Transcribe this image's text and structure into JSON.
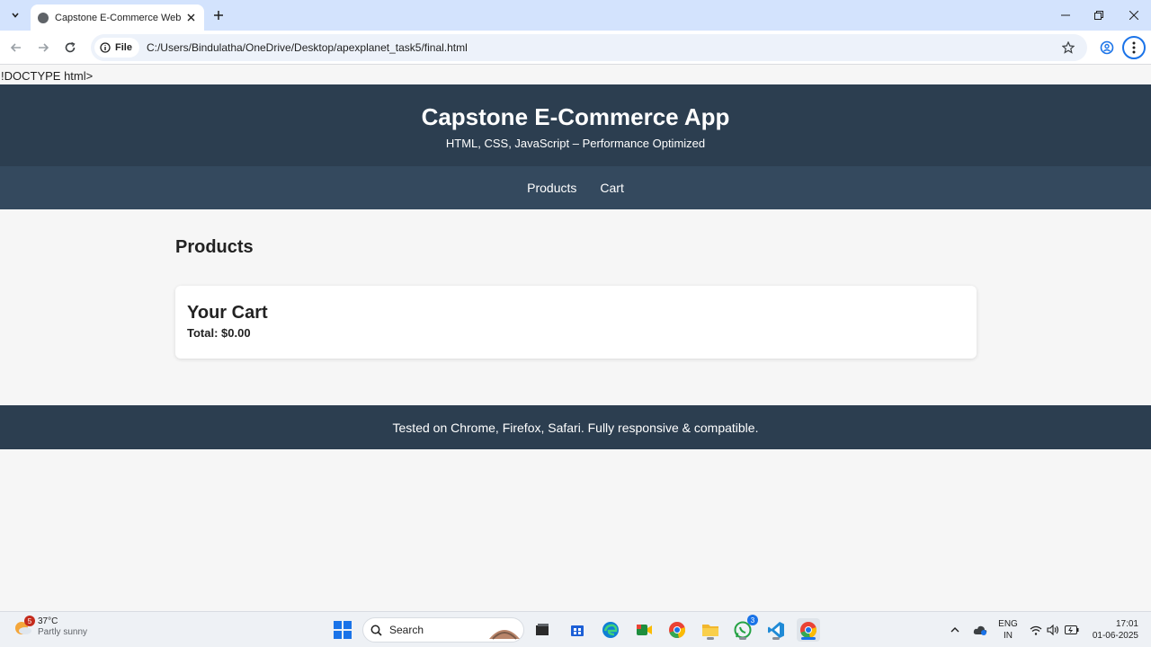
{
  "browser": {
    "tab_title": "Capstone E-Commerce Web App",
    "chip_label": "File",
    "url": "C:/Users/Bindulatha/OneDrive/Desktop/apexplanet_task5/final.html"
  },
  "page": {
    "doctype_text": "!DOCTYPE html>",
    "header": {
      "title": "Capstone E-Commerce App",
      "subtitle": "HTML, CSS, JavaScript – Performance Optimized"
    },
    "nav": {
      "products": "Products",
      "cart": "Cart"
    },
    "products_heading": "Products",
    "cart": {
      "title": "Your Cart",
      "total": "Total: $0.00"
    },
    "footer": "Tested on Chrome, Firefox, Safari. Fully responsive & compatible."
  },
  "taskbar": {
    "weather": {
      "temp": "37°C",
      "desc": "Partly sunny",
      "badge": "5"
    },
    "search_label": "Search",
    "whatsapp_badge": "3",
    "lang": {
      "line1": "ENG",
      "line2": "IN"
    },
    "clock": {
      "time": "17:01",
      "date": "01-06-2025"
    }
  },
  "colors": {
    "header_bg": "#2c3e50",
    "nav_bg": "#34495e",
    "page_bg": "#f6f6f6",
    "tabstrip_bg": "#d3e3fd"
  }
}
